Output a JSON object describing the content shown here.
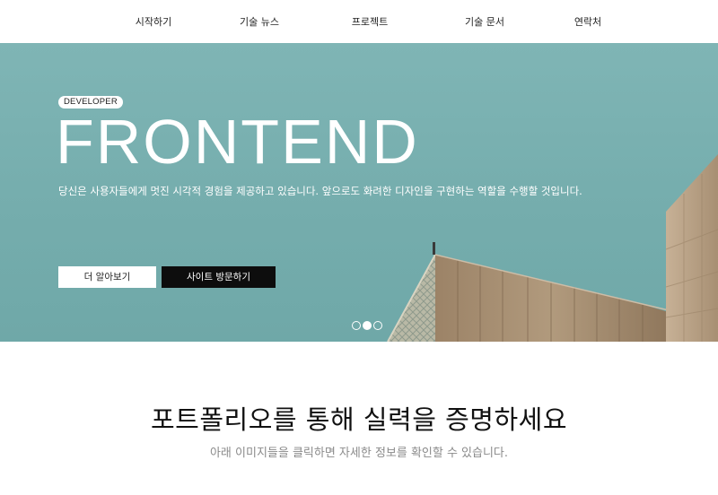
{
  "nav": {
    "items": [
      "시작하기",
      "기술 뉴스",
      "프로젝트",
      "기술 문서",
      "연락처"
    ]
  },
  "hero": {
    "badge": "DEVELOPER",
    "title": "FRONTEND",
    "description": "당신은 사용자들에게 멋진 시각적 경험을 제공하고 있습니다. 앞으로도 화려한 디자인을 구현하는 역할을 수행할 것입니다.",
    "primary_button": "더 알아보기",
    "secondary_button": "사이트 방문하기",
    "slides": {
      "count": 3,
      "active_index": 1
    }
  },
  "portfolio": {
    "title": "포트폴리오를 통해 실력을 증명하세요",
    "subtitle": "아래 이미지들을 클릭하면 자세한 정보를 확인할 수 있습니다."
  },
  "colors": {
    "hero_sky": "#7fb5b5",
    "wood": "#a89074",
    "dark_button": "#0d0d0d"
  }
}
